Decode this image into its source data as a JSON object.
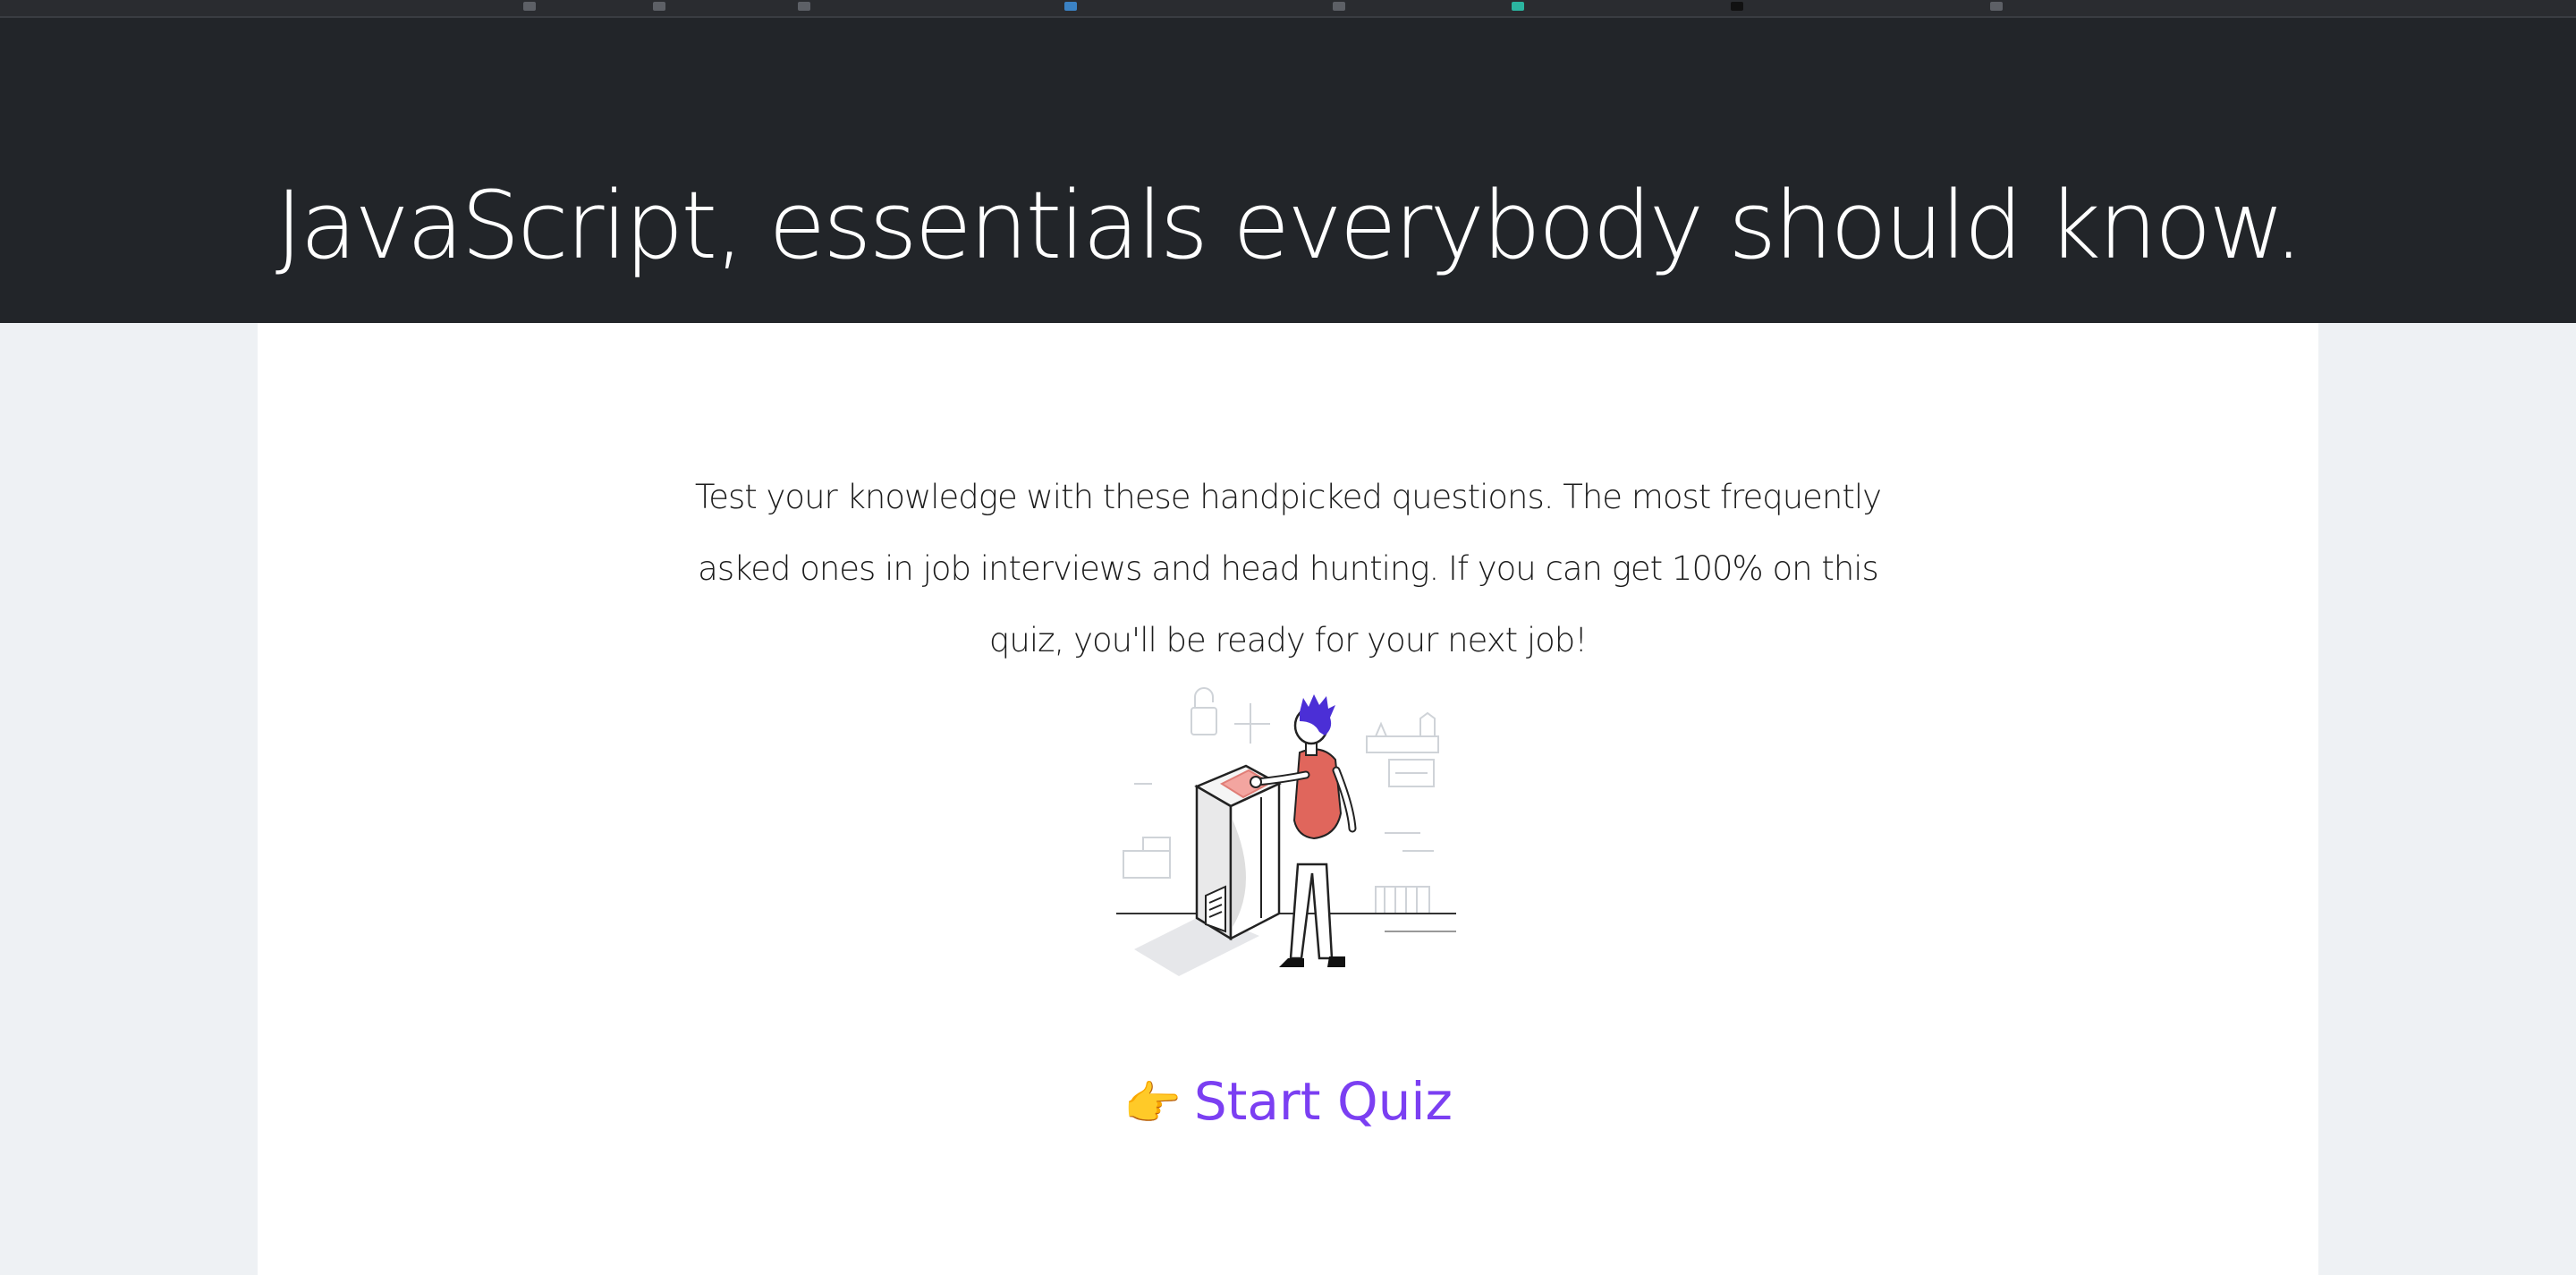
{
  "header": {
    "title": "JavaScript, essentials everybody should know."
  },
  "intro": {
    "text": "Test your knowledge with these handpicked questions. The most frequently asked ones in job interviews and head hunting. If you can get 100% on this quiz, you'll be ready for your next job!"
  },
  "illustration": {
    "icon": "person-at-voting-box-illustration"
  },
  "start_quiz": {
    "icon": "pointing-hand-emoji",
    "pointer": "👉",
    "label": "Start Quiz",
    "color": "#7b3ff2"
  },
  "colors": {
    "header_bg": "#222529",
    "page_bg": "#eef1f4",
    "card_bg": "#ffffff",
    "accent": "#7b3ff2",
    "shirt": "#e0665c",
    "hair": "#4b2fd6"
  }
}
